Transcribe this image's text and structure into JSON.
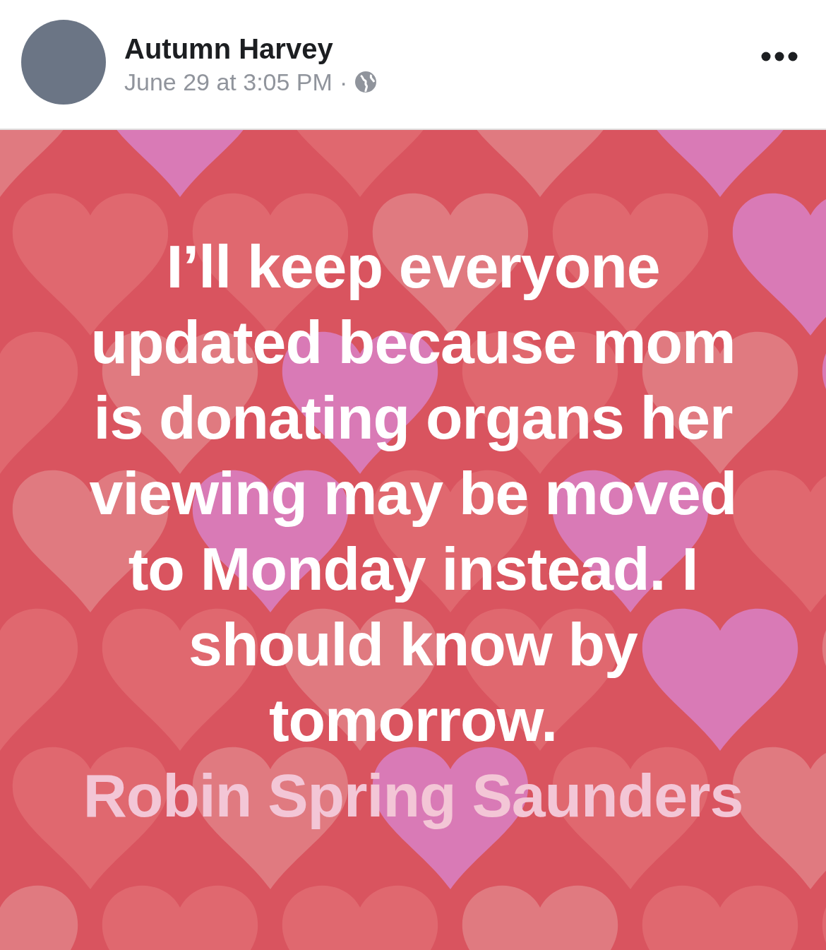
{
  "post": {
    "author": "Autumn Harvey",
    "timestamp": "June 29 at 3:05 PM",
    "meta_separator": "·",
    "audience_public": true,
    "body": {
      "text": "I’ll keep everyone updated because mom is donating organs her viewing may be moved to Monday instead. I should know by tomorrow.",
      "mention": "Robin Spring Saunders"
    }
  }
}
